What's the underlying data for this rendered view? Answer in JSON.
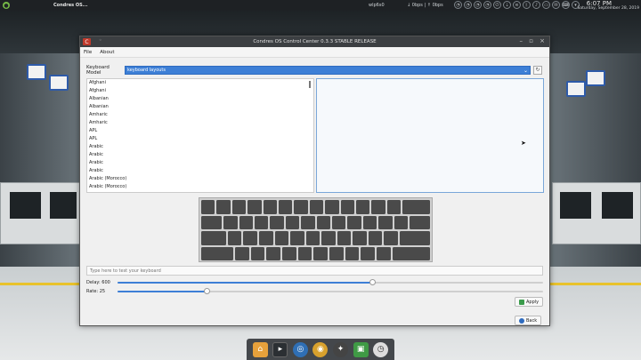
{
  "topbar": {
    "app_name": "Condres OS...",
    "network": "wlp6s0",
    "speed_down": "↓ 0bps",
    "speed_up": "↑ 0bps",
    "time": "6:07 PM",
    "date": "Saturday, September 28, 2019"
  },
  "window": {
    "title": "Condres OS Control Center 0.3.3 STABLE RELEASE",
    "menu": [
      "File",
      "About"
    ],
    "keyboard_model_label": "Keyboard Model",
    "keyboard_model_value": "keyboard layouts",
    "layouts": [
      "Afghani",
      "Afghani",
      "Albanian",
      "Albanian",
      "Amharic",
      "Amharic",
      "APL",
      "APL",
      "Arabic",
      "Arabic",
      "Arabic",
      "Arabic",
      "Arabic (Morocco)",
      "Arabic (Morocco)"
    ],
    "test_placeholder": "Type here to test your keyboard",
    "delay_label": "Delay:",
    "delay_value": "600",
    "delay_fraction": 0.6,
    "rate_label": "Rate:",
    "rate_value": "25",
    "rate_fraction": 0.21,
    "apply_label": "Apply",
    "back_label": "Back"
  },
  "colors": {
    "accent": "#3d7fd6",
    "titlebar": "#3c3f42"
  }
}
